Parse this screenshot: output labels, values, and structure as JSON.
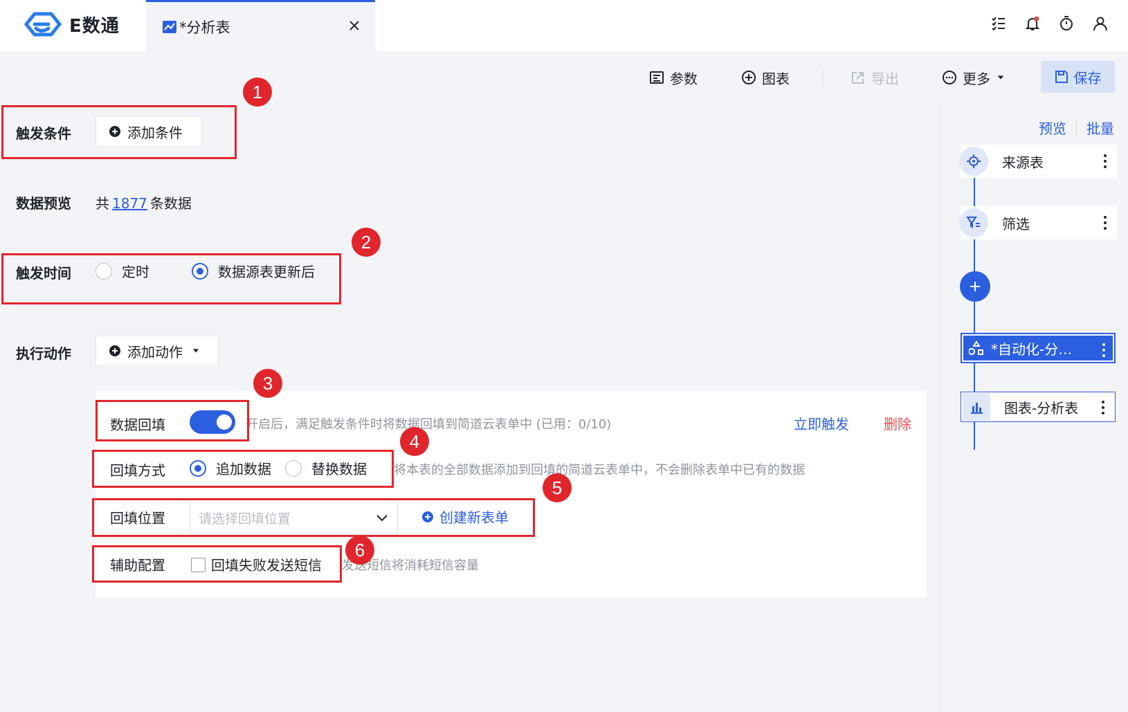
{
  "app": {
    "brand": "E数通",
    "tab_title": "*分析表"
  },
  "toolbar": {
    "params": "参数",
    "chart": "图表",
    "export": "导出",
    "more": "更多",
    "save": "保存"
  },
  "trigger_condition": {
    "label": "触发条件",
    "add_button": "添加条件"
  },
  "data_preview": {
    "label": "数据预览",
    "prefix": "共",
    "count": "1877",
    "suffix": "条数据"
  },
  "trigger_time": {
    "label": "触发时间",
    "options": [
      {
        "label": "定时",
        "selected": false
      },
      {
        "label": "数据源表更新后",
        "selected": true
      }
    ]
  },
  "action": {
    "label": "执行动作",
    "add_button": "添加动作",
    "backfill": {
      "label": "数据回填",
      "enabled": true,
      "hint": "开启后，满足触发条件时将数据回填到简道云表单中 (已用：0/10)",
      "trigger_now": "立即触发",
      "delete": "删除"
    },
    "mode": {
      "label": "回填方式",
      "options": [
        {
          "label": "追加数据",
          "selected": true
        },
        {
          "label": "替换数据",
          "selected": false
        }
      ],
      "hint": "将本表的全部数据添加到回填的简道云表单中，不会删除表单中已有的数据"
    },
    "position": {
      "label": "回填位置",
      "placeholder": "请选择回填位置",
      "create_form": "创建新表单"
    },
    "aux": {
      "label": "辅助配置",
      "checkbox_label": "回填失败发送短信",
      "checked": false,
      "hint": "发送短信将消耗短信容量"
    }
  },
  "annotations": [
    "1",
    "2",
    "3",
    "4",
    "5",
    "6"
  ],
  "flow_panel": {
    "preview": "预览",
    "batch": "批量",
    "nodes": [
      {
        "label": "来源表",
        "icon": "target-icon"
      },
      {
        "label": "筛选",
        "icon": "filter-icon"
      },
      {
        "label": "*自动化-分…",
        "icon": "automation-icon",
        "active": true
      },
      {
        "label": "图表-分析表",
        "icon": "bar-chart-icon"
      }
    ]
  },
  "colors": {
    "accent": "#2b5fe0",
    "danger": "#e34d4d",
    "annotation": "#e0262c"
  }
}
